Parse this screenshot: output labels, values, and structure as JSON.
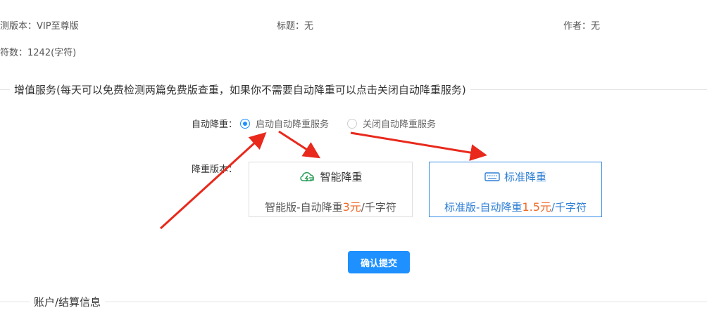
{
  "info": {
    "version_label": "测版本：",
    "version_value": "VIP至尊版",
    "title_label": "标题：",
    "title_value": "无",
    "author_label": "作者：",
    "author_value": "无",
    "chars_label": "符数：",
    "chars_value": "1242(字符)"
  },
  "value_added": {
    "title": "增值服务(每天可以免费检测两篇免费版查重，如果你不需要自动降重可以点击关闭自动降重服务)",
    "auto_label": "自动降重：",
    "options": [
      {
        "label": "启动自动降重服务",
        "checked": true
      },
      {
        "label": "关闭自动降重服务",
        "checked": false
      }
    ],
    "version_label": "降重版本：",
    "cards": [
      {
        "title": "智能降重",
        "desc_prefix": "智能版-自动降重",
        "price": "3元",
        "desc_suffix": "/千字符",
        "icon": "cloud-icon",
        "selected": false
      },
      {
        "title": "标准降重",
        "desc_prefix": "标准版-自动降重",
        "price": "1.5元",
        "desc_suffix": "/千字符",
        "icon": "keyboard-icon",
        "selected": true
      }
    ],
    "submit_label": "确认提交"
  },
  "account": {
    "title": "账户/结算信息"
  },
  "colors": {
    "accent": "#1e90ff",
    "price": "#f06a2a",
    "arrow": "#e8291c"
  }
}
